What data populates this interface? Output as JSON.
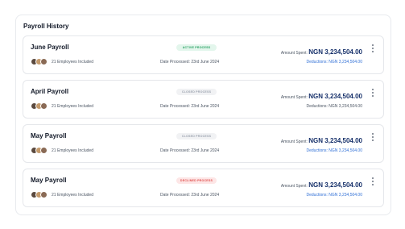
{
  "panel": {
    "title": "Payroll History"
  },
  "payrolls": [
    {
      "name": "June Payroll",
      "status": "ACTIVE PROCESS",
      "employees": "21 Employees Included",
      "date_processed": "Date Processed: 23rd June 2024",
      "amount_label": "Amount Spent:",
      "amount_value": "NGN 3,234,504.00",
      "deductions": "Deductions: NGN 3,234,504.00"
    },
    {
      "name": "April Payroll",
      "status": "CLOSED PROCESS",
      "employees": "21 Employees Included",
      "date_processed": "Date Processed: 23rd June 2024",
      "amount_label": "Amount Spent:",
      "amount_value": "NGN 3,234,504.00",
      "deductions": "Deductions: NGN 3,234,504.00"
    },
    {
      "name": "May Payroll",
      "status": "CLOSED PROCESS",
      "employees": "21 Employees Included",
      "date_processed": "Date Processed: 23rd June 2024",
      "amount_label": "Amount Spent:",
      "amount_value": "NGN 3,234,504.00",
      "deductions": "Deductions: NGN 3,234,504.00"
    },
    {
      "name": "May Payroll",
      "status": "DECLINED PROCESS",
      "employees": "21 Employees Included",
      "date_processed": "Date Processed: 23rd June 2024",
      "amount_label": "Amount Spent:",
      "amount_value": "NGN 3,234,504.00",
      "deductions": "Deductions: NGN 3,234,504.00"
    }
  ],
  "colors": {
    "active": "#27a062",
    "closed": "#9ca3af",
    "declined": "#e0514f",
    "amount": "#16306a",
    "link": "#2f6fd6"
  },
  "icons": {
    "menu": "kebab-icon",
    "avatars": "avatar-group"
  }
}
